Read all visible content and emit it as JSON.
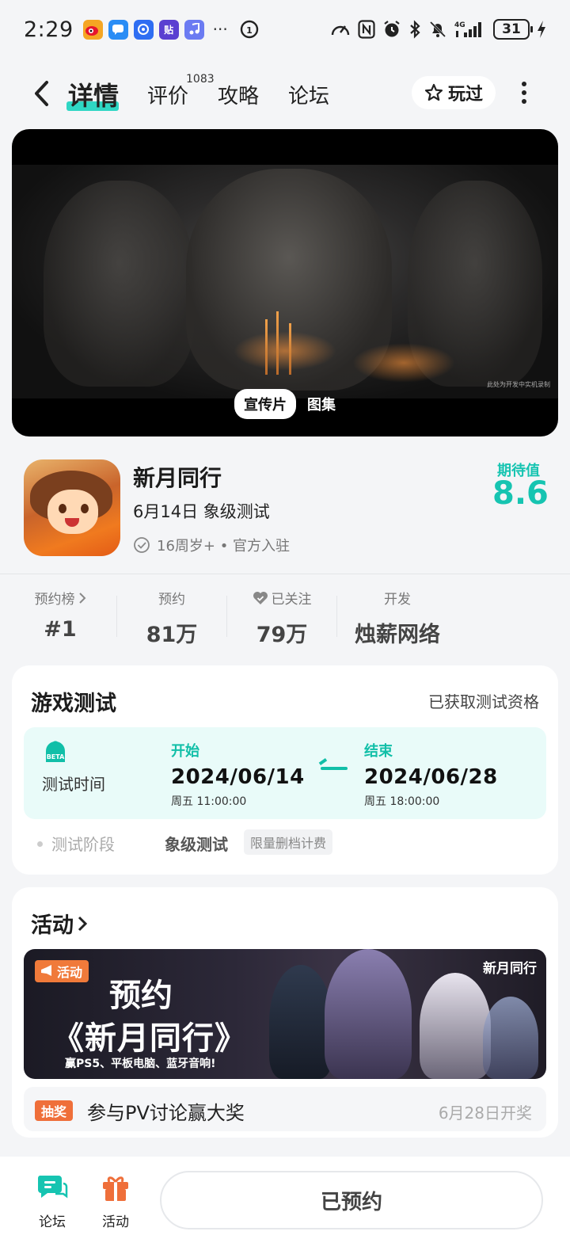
{
  "status_bar": {
    "time": "2:29",
    "more": "···",
    "network": "4G",
    "battery": "31"
  },
  "nav": {
    "tabs": [
      {
        "label": "详情",
        "active": true
      },
      {
        "label": "评价",
        "count": "1083"
      },
      {
        "label": "攻略"
      },
      {
        "label": "论坛"
      }
    ],
    "played_label": "玩过"
  },
  "video": {
    "tabs": [
      "宣传片",
      "图集"
    ],
    "watermark": "此处为开发中实机录制"
  },
  "game": {
    "title": "新月同行",
    "subtitle": "6月14日 象级测试",
    "meta": "16周岁+ • 官方入驻",
    "expect_label": "期待值",
    "expect_value": "8.6"
  },
  "stats": [
    {
      "label": "预约榜",
      "value": "#1"
    },
    {
      "label": "预约",
      "value": "81万"
    },
    {
      "label": "已关注",
      "value": "79万"
    },
    {
      "label": "开发",
      "value": "烛薪网络"
    }
  ],
  "test_card": {
    "title": "游戏测试",
    "qualification": "已获取测试资格",
    "time_label": "测试时间",
    "start": {
      "head": "开始",
      "date": "2024/06/14",
      "time": "周五  11:00:00"
    },
    "end": {
      "head": "结束",
      "date": "2024/06/28",
      "time": "周五  18:00:00"
    },
    "phase_label": "测试阶段",
    "phase_value": "象级测试",
    "phase_tag": "限量删档计费"
  },
  "activity_card": {
    "title": "活动",
    "banner_tag": "活动",
    "banner_big": "预约",
    "banner_main": "《新月同行》",
    "banner_prize": "赢PS5、平板电脑、蓝牙音响!",
    "banner_logo": "新月同行",
    "lottery_tag": "抽奖",
    "lottery_text": "参与PV讨论赢大奖",
    "lottery_date": "6月28日开奖"
  },
  "bottom_bar": {
    "forum_label": "论坛",
    "activity_label": "活动",
    "reserve_label": "已预约"
  },
  "colors": {
    "accent": "#16c4b1",
    "orange": "#ef6f3a",
    "background": "#f4f5f7"
  }
}
